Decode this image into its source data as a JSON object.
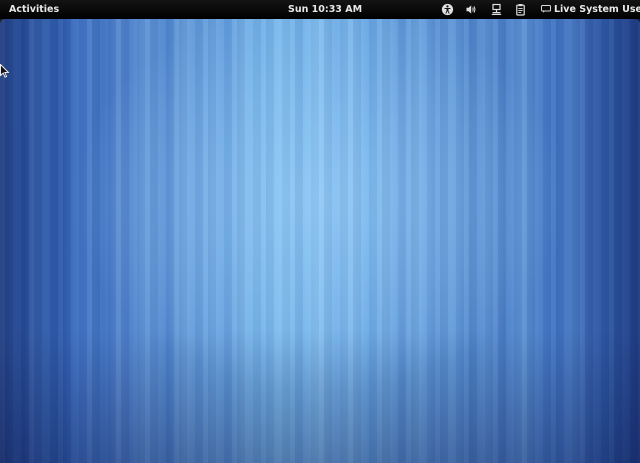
{
  "top_bar": {
    "activities_label": "Activities",
    "clock_text": "Sun 10:33 AM",
    "status_icons": [
      "accessibility-icon",
      "volume-icon",
      "network-icon",
      "clipboard-icon"
    ],
    "user_icon": "chat-status-icon",
    "user_name": "Live System User"
  },
  "desktop": {
    "wallpaper": "blue-vertical-stripes",
    "accent_color": "#6aa8e4",
    "pointer_icon": "mouse-pointer-icon"
  }
}
